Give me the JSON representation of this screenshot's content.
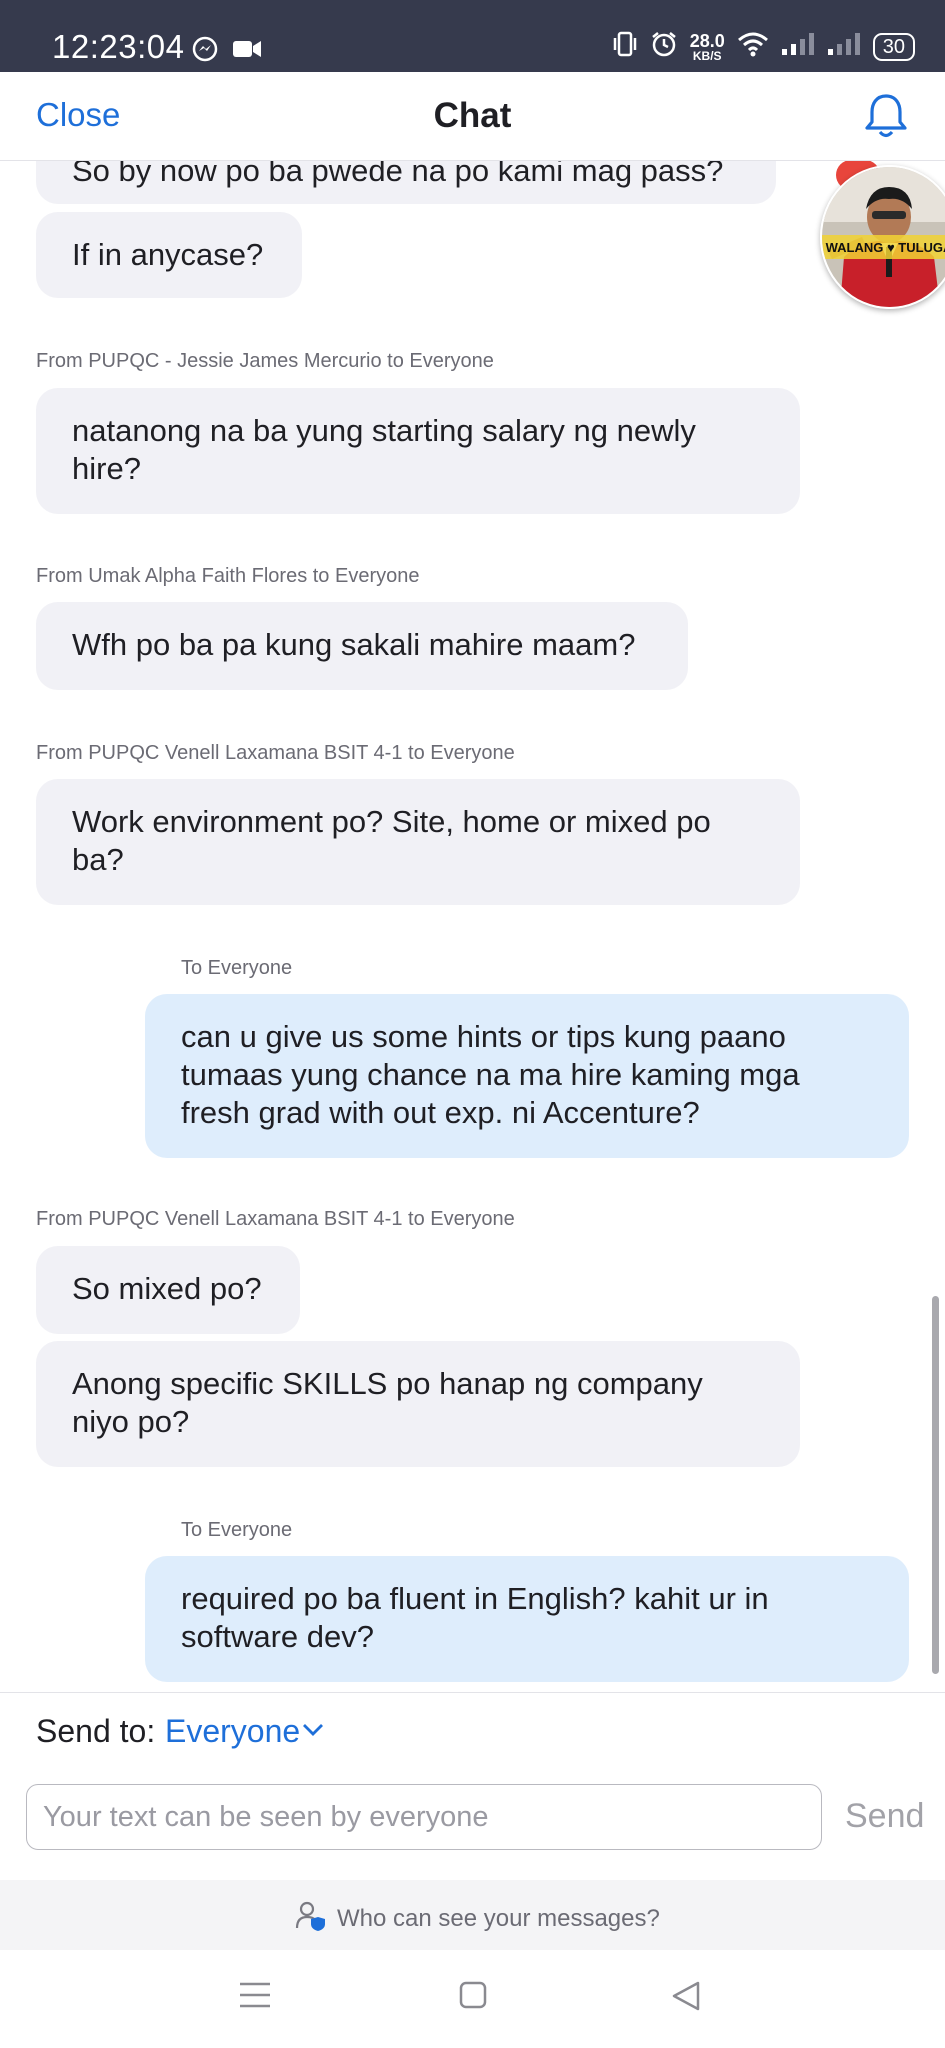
{
  "status_bar": {
    "time": "12:23:04",
    "net_speed_value": "28.0",
    "net_speed_unit": "KB/S",
    "battery": "30"
  },
  "header": {
    "close_label": "Close",
    "title": "Chat"
  },
  "avatar": {
    "overlay_text": "WALANG ♥ TULUGA"
  },
  "messages": [
    {
      "text": "So by now po ba pwede na po kami mag pass?"
    },
    {
      "text": "If in anycase?"
    },
    {
      "sender": "From PUPQC - Jessie James Mercurio to Everyone",
      "text": "natanong na ba yung starting salary ng newly hire?"
    },
    {
      "sender": "From Umak Alpha Faith Flores to Everyone",
      "text": "Wfh po ba pa kung sakali mahire maam?"
    },
    {
      "sender": "From PUPQC Venell Laxamana BSIT 4-1 to Everyone",
      "text": "Work environment po? Site, home or mixed po ba?"
    },
    {
      "sender": "To Everyone",
      "text": "can u give us some hints or tips kung paano tumaas yung chance na ma hire kaming mga fresh grad with out exp. ni Accenture?"
    },
    {
      "sender": "From PUPQC Venell Laxamana BSIT 4-1 to Everyone",
      "text": "So mixed po?"
    },
    {
      "text": "Anong specific SKILLS po hanap ng company niyo po?"
    },
    {
      "sender": "To Everyone",
      "text": "required po ba fluent in English? kahit ur in software dev?"
    }
  ],
  "send_to": {
    "label": "Send to:",
    "value": "Everyone"
  },
  "input": {
    "placeholder": "Your text can be seen by everyone",
    "value": ""
  },
  "send_label": "Send",
  "who_can_see": "Who can see your messages?",
  "colors": {
    "accent": "#1e6fd9",
    "status_bar": "#363a4d",
    "incoming_bubble": "#f1f1f6",
    "outgoing_bubble": "#deedfc"
  },
  "icons": [
    "messenger-icon",
    "video-icon",
    "vibrate-icon",
    "alarm-icon",
    "wifi-icon",
    "signal-icon",
    "bell-icon",
    "chevron-down-icon",
    "privacy-user-icon",
    "menu-icon",
    "home-icon",
    "back-icon"
  ]
}
